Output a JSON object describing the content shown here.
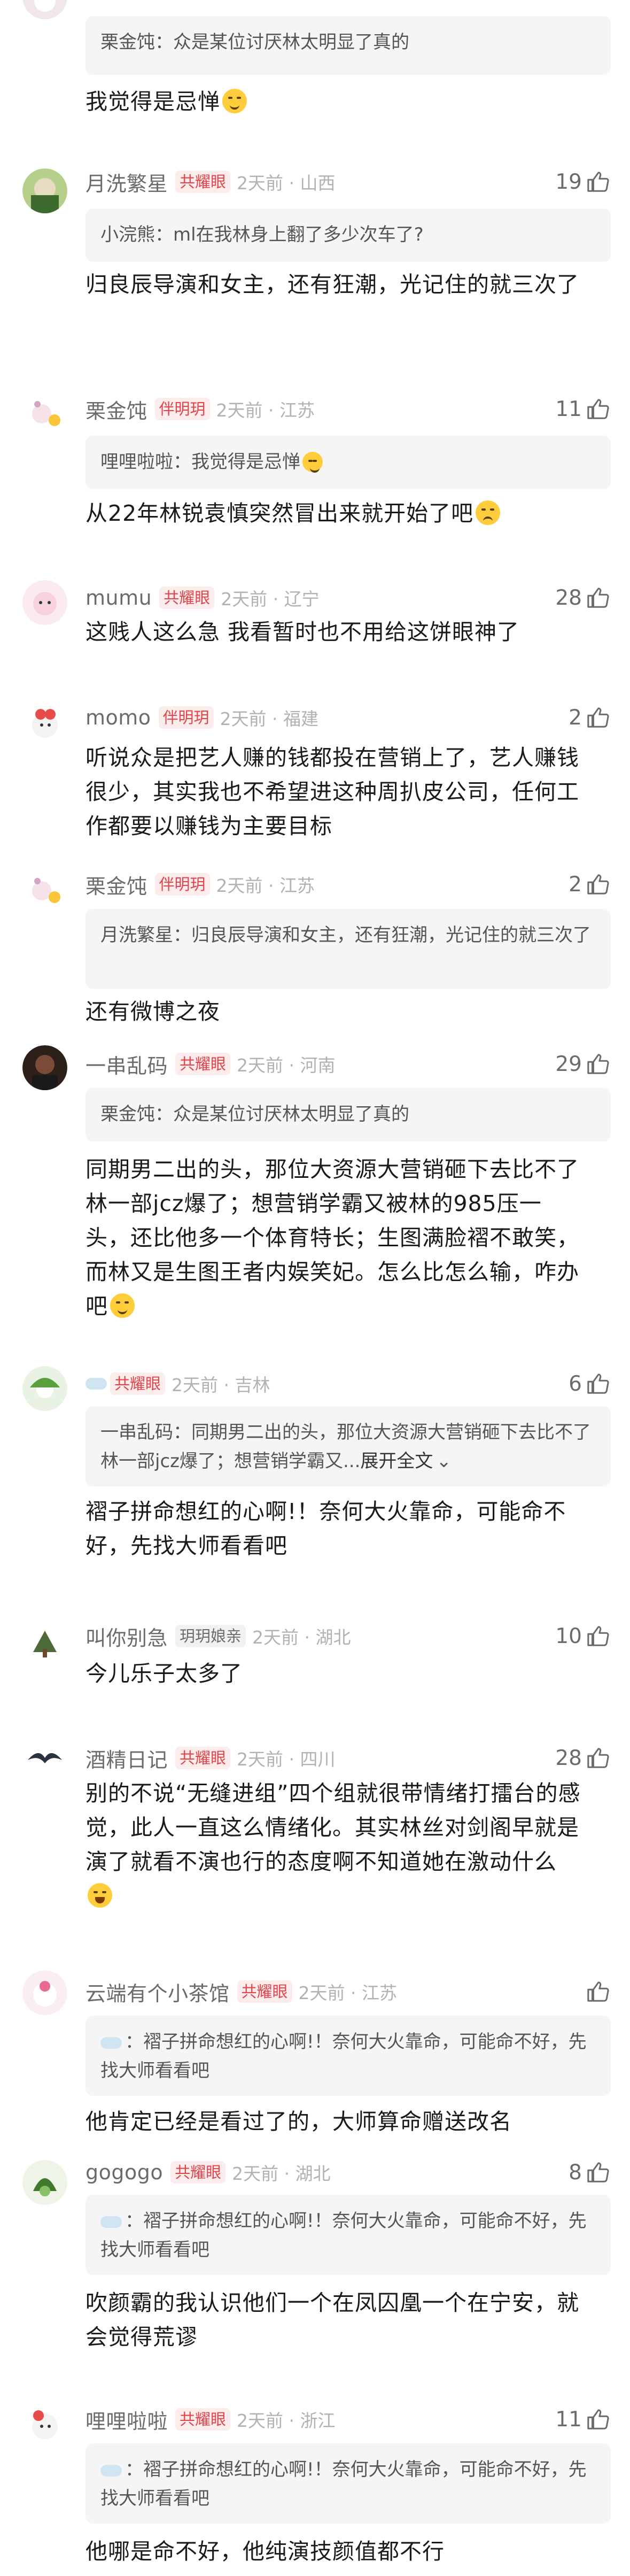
{
  "comments": [
    {
      "quote_name": "栗金饨：",
      "quote_text": "众是某位讨厌林太明显了真的",
      "body": "我觉得是忌惮",
      "emoji": "smile"
    },
    {
      "username": "月洗繁星",
      "badge": "共耀眼",
      "time": "2天前 · 山西",
      "likes": "19",
      "quote_name": "小浣熊：",
      "quote_text": "ml在我林身上翻了多少次车了?",
      "body": "归良辰导演和女主，还有狂潮，光记住的就三次了"
    },
    {
      "username": "栗金饨",
      "badge": "伴明玥",
      "time": "2天前 · 江苏",
      "likes": "11",
      "quote_name": "哩哩啦啦：",
      "quote_text": "我觉得是忌惮",
      "body": "从22年林锐袁慎突然冒出来就开始了吧",
      "emoji": "sad"
    },
    {
      "username": "mumu",
      "badge": "共耀眼",
      "time": "2天前 · 辽宁",
      "likes": "28",
      "body": "这贱人这么急 我看暂时也不用给这饼眼神了"
    },
    {
      "username": "momo",
      "badge": "伴明玥",
      "time": "2天前 · 福建",
      "likes": "2",
      "body": "听说众是把艺人赚的钱都投在营销上了，艺人赚钱很少，其实我也不希望进这种周扒皮公司，任何工作都要以赚钱为主要目标"
    },
    {
      "username": "栗金饨",
      "badge": "伴明玥",
      "time": "2天前 · 江苏",
      "likes": "2",
      "quote_name": "月洗繁星：",
      "quote_text": "归良辰导演和女主，还有狂潮，光记住的就三次了",
      "body": "还有微博之夜"
    },
    {
      "username": "一串乱码",
      "badge": "共耀眼",
      "time": "2天前 · 河南",
      "likes": "29",
      "quote_name": "栗金饨：",
      "quote_text": "众是某位讨厌林太明显了真的",
      "body": "同期男二出的头，那位大资源大营销砸下去比不了林一部jcz爆了；想营销学霸又被林的985压一头，还比他多一个体育特长；生图满脸褶不敢笑，而林又是生图王者内娱笑妃。怎么比怎么输，咋办吧",
      "emoji": "smile"
    },
    {
      "username": "",
      "badge": "共耀眼",
      "time": "2天前 · 吉林",
      "likes": "6",
      "quote_name": "一串乱码：",
      "quote_text": "同期男二出的头，那位大资源大营销砸下去比不了林一部jcz爆了；想营销学霸又...",
      "quote_expand": "展开全文",
      "body": "褶子拼命想红的心啊!！奈何大火靠命，可能命不好，先找大师看看吧"
    },
    {
      "username": "叫你别急",
      "badge": "玥玥娘亲",
      "time": "2天前 · 湖北",
      "likes": "10",
      "body": "今儿乐子太多了"
    },
    {
      "username": "酒精日记",
      "badge": "共耀眼",
      "time": "2天前 · 四川",
      "likes": "28",
      "body": "别的不说“无缝进组”四个组就很带情绪打擂台的感觉，此人一直这么情绪化。其实林丝对剑阁早就是演了就看不演也行的态度啊不知道她在激动什么",
      "emoji": "laugh"
    },
    {
      "username": "云端有个小茶馆",
      "badge": "共耀眼",
      "time": "2天前 · 江苏",
      "likes": "",
      "quote_name": "：",
      "quote_text": "褶子拼命想红的心啊!！奈何大火靠命，可能命不好，先找大师看看吧",
      "body": "他肯定已经是看过了的，大师算命赠送改名"
    },
    {
      "username": "gogogo",
      "badge": "共耀眼",
      "time": "2天前 · 湖北",
      "likes": "8",
      "quote_name": "：",
      "quote_text": "褶子拼命想红的心啊!！奈何大火靠命，可能命不好，先找大师看看吧",
      "body": "吹颜霸的我认识他们一个在凤囚凰一个在宁安，就会觉得荒谬"
    },
    {
      "username": "哩哩啦啦",
      "badge": "共耀眼",
      "time": "2天前 · 浙江",
      "likes": "11",
      "quote_name": "：",
      "quote_text": "褶子拼命想红的心啊!！奈何大火靠命，可能命不好，先找大师看看吧",
      "body": "他哪是命不好，他纯演技颜值都不行"
    }
  ],
  "colors": {
    "badge_red": "#e0454b",
    "meta": "#b2b2b2",
    "quote_bg": "#f5f5f5"
  },
  "icons": {
    "like": "thumbs-up-icon"
  }
}
